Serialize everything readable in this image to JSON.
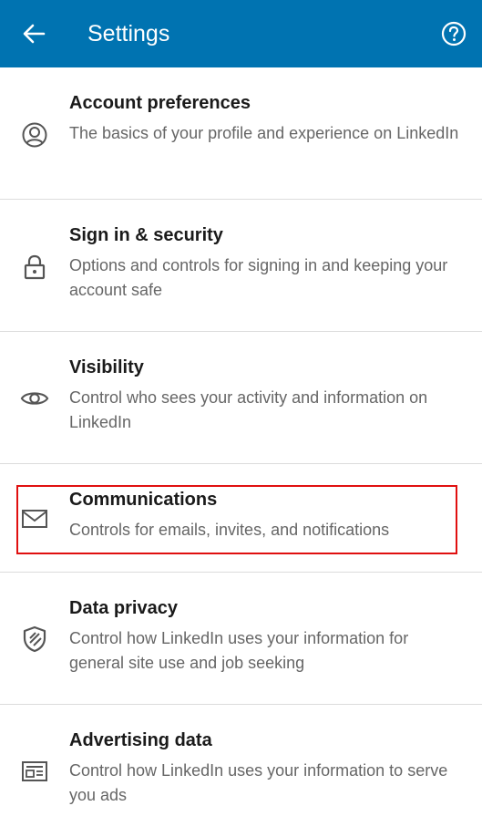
{
  "app_bar": {
    "title": "Settings",
    "background": "#0073b1",
    "back_icon": "arrow-left-icon",
    "help_icon": "help-circle-icon"
  },
  "items": [
    {
      "icon": "person-circle-icon",
      "title": "Account preferences",
      "description": "The basics of your profile and experience on LinkedIn"
    },
    {
      "icon": "lock-icon",
      "title": "Sign in & security",
      "description": "Options and controls for signing in and keeping your account safe"
    },
    {
      "icon": "eye-icon",
      "title": "Visibility",
      "description": "Control who sees your activity and information on LinkedIn"
    },
    {
      "icon": "envelope-icon",
      "title": "Communications",
      "description": "Controls for emails, invites, and notifications"
    },
    {
      "icon": "shield-icon",
      "title": "Data privacy",
      "description": "Control how LinkedIn uses your information for general site use and job seeking"
    },
    {
      "icon": "ad-card-icon",
      "title": "Advertising data",
      "description": "Control how LinkedIn uses your information to serve you ads"
    }
  ],
  "highlight_color": "#e01010"
}
